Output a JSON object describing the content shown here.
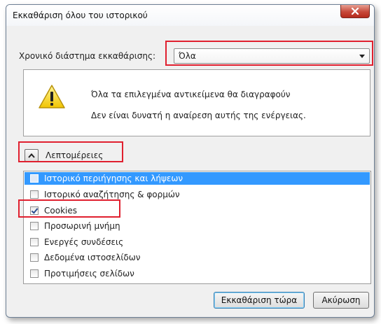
{
  "window": {
    "title": "Εκκαθάριση όλου του ιστορικού"
  },
  "range": {
    "label": "Χρονικό διάστημα εκκαθάρισης:",
    "selected": "Όλα"
  },
  "warning": {
    "icon": "warning-icon",
    "line1": "Όλα τα επιλεγμένα αντικείμενα θα διαγραφούν",
    "line2": "Δεν είναι δυνατή η αναίρεση αυτής της ενέργειας."
  },
  "details": {
    "label": "Λεπτομέρειες",
    "expanded": true
  },
  "items": [
    {
      "label": "Ιστορικό περιήγησης και λήψεων",
      "checked": false,
      "selected": true
    },
    {
      "label": "Ιστορικό αναζήτησης & φορμών",
      "checked": false,
      "selected": false
    },
    {
      "label": "Cookies",
      "checked": true,
      "selected": false
    },
    {
      "label": "Προσωρινή μνήμη",
      "checked": false,
      "selected": false
    },
    {
      "label": "Ενεργές συνδέσεις",
      "checked": false,
      "selected": false
    },
    {
      "label": "Δεδομένα ιστοσελίδων",
      "checked": false,
      "selected": false
    },
    {
      "label": "Προτιμήσεις σελίδων",
      "checked": false,
      "selected": false
    }
  ],
  "buttons": {
    "clear_now": "Εκκαθάριση τώρα",
    "cancel": "Ακύρωση"
  },
  "colors": {
    "selection": "#3399ff",
    "highlight": "#e0202f",
    "close": "#c7493a"
  }
}
